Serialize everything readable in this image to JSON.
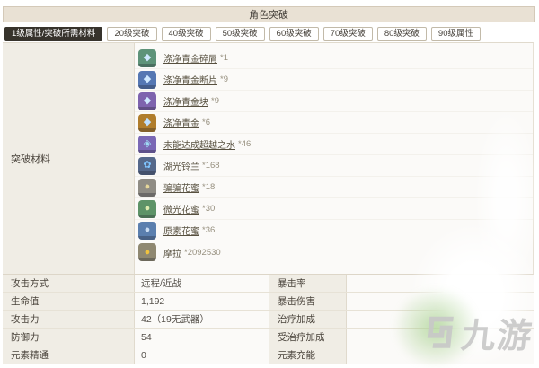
{
  "header": {
    "title": "角色突破"
  },
  "tabs": [
    {
      "label": "1级属性/突破所需材料",
      "active": true
    },
    {
      "label": "20级突破",
      "active": false
    },
    {
      "label": "40级突破",
      "active": false
    },
    {
      "label": "50级突破",
      "active": false
    },
    {
      "label": "60级突破",
      "active": false
    },
    {
      "label": "70级突破",
      "active": false
    },
    {
      "label": "80级突破",
      "active": false
    },
    {
      "label": "90级属性",
      "active": false
    }
  ],
  "materials": {
    "label": "突破材料",
    "items": [
      {
        "name": "涤净青金碎屑",
        "count": "*1",
        "icon_bg": "#5e9379",
        "glyph": "◆",
        "glyph_color": "#cfe8ff"
      },
      {
        "name": "涤净青金断片",
        "count": "*9",
        "icon_bg": "#5577b3",
        "glyph": "◆",
        "glyph_color": "#cfe8ff"
      },
      {
        "name": "涤净青金块",
        "count": "*9",
        "icon_bg": "#7e63ae",
        "glyph": "◆",
        "glyph_color": "#cfe8ff"
      },
      {
        "name": "涤净青金",
        "count": "*6",
        "icon_bg": "#b07d2c",
        "glyph": "◆",
        "glyph_color": "#bfe0ff"
      },
      {
        "name": "未能达成超越之水",
        "count": "*46",
        "icon_bg": "#7a68b5",
        "glyph": "◈",
        "glyph_color": "#9fdcf5"
      },
      {
        "name": "湖光铃兰",
        "count": "*168",
        "icon_bg": "#55688a",
        "glyph": "✿",
        "glyph_color": "#7fc4ff"
      },
      {
        "name": "骗骗花蜜",
        "count": "*18",
        "icon_bg": "#8f8c84",
        "glyph": "●",
        "glyph_color": "#e6d79a"
      },
      {
        "name": "微光花蜜",
        "count": "*30",
        "icon_bg": "#5d9367",
        "glyph": "●",
        "glyph_color": "#dcebae"
      },
      {
        "name": "原素花蜜",
        "count": "*36",
        "icon_bg": "#5b7fae",
        "glyph": "●",
        "glyph_color": "#c9dcf2"
      },
      {
        "name": "摩拉",
        "count": "*2092530",
        "icon_bg": "#8f8871",
        "glyph": "●",
        "glyph_color": "#f0c23e"
      }
    ]
  },
  "stats": {
    "rows": [
      {
        "label": "攻击方式",
        "value": "远程/近战",
        "label2": "暴击率",
        "value2": ""
      },
      {
        "label": "生命值",
        "value": "1,192",
        "label2": "暴击伤害",
        "value2": ""
      },
      {
        "label": "攻击力",
        "value": "42（19无武器）",
        "label2": "治疗加成",
        "value2": ""
      },
      {
        "label": "防御力",
        "value": "54",
        "label2": "受治疗加成",
        "value2": ""
      },
      {
        "label": "元素精通",
        "value": "0",
        "label2": "元素充能",
        "value2": ""
      }
    ]
  },
  "watermark": {
    "text": "九游",
    "color": "#c8c8c8"
  }
}
